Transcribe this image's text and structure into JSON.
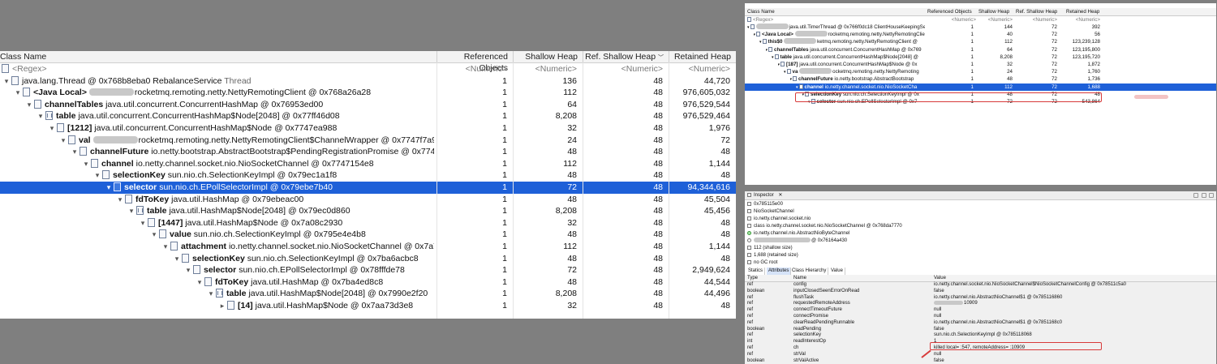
{
  "left": {
    "columns": {
      "name": "Class Name",
      "refs": "Referenced Objects",
      "shallow": "Shallow Heap",
      "ref_shallow": "Ref. Shallow Heap",
      "retained": "Retained Heap"
    },
    "filter": {
      "name": "<Regex>",
      "refs": "<Numeric>",
      "shallow": "<Numeric>",
      "ref_shallow": "<Numeric>",
      "retained": "<Numeric>"
    },
    "rows": [
      {
        "depth": 0,
        "tw": "▾",
        "icon": "thread",
        "field": "",
        "text": "java.lang.Thread @ 0x768b8eba0  RebalanceService",
        "tail": "Thread",
        "blur": false,
        "refs": "1",
        "shallow": "136",
        "ref_shallow": "48",
        "retained": "44,720"
      },
      {
        "depth": 1,
        "tw": "▾",
        "icon": "obj",
        "field": "<Java Local>",
        "text": "rocketmq.remoting.netty.NettyRemotingClient @ 0x768a26a28",
        "blur": true,
        "refs": "1",
        "shallow": "112",
        "ref_shallow": "48",
        "retained": "976,605,032"
      },
      {
        "depth": 2,
        "tw": "▾",
        "icon": "obj",
        "field": "channelTables",
        "text": "java.util.concurrent.ConcurrentHashMap @ 0x76953ed00",
        "blur": false,
        "refs": "1",
        "shallow": "64",
        "ref_shallow": "48",
        "retained": "976,529,544"
      },
      {
        "depth": 3,
        "tw": "▾",
        "icon": "arr",
        "field": "table",
        "text": "java.util.concurrent.ConcurrentHashMap$Node[2048] @ 0x77ff46d08",
        "blur": false,
        "refs": "1",
        "shallow": "8,208",
        "ref_shallow": "48",
        "retained": "976,529,464"
      },
      {
        "depth": 4,
        "tw": "▾",
        "icon": "obj",
        "field": "[1212]",
        "text": "java.util.concurrent.ConcurrentHashMap$Node @ 0x7747ea988",
        "blur": false,
        "refs": "1",
        "shallow": "32",
        "ref_shallow": "48",
        "retained": "1,976"
      },
      {
        "depth": 5,
        "tw": "▾",
        "icon": "obj",
        "field": "val",
        "text": "rocketmq.remoting.netty.NettyRemotingClient$ChannelWrapper @ 0x7747f7a9",
        "blur": true,
        "refs": "1",
        "shallow": "24",
        "ref_shallow": "48",
        "retained": "72"
      },
      {
        "depth": 6,
        "tw": "▾",
        "icon": "obj",
        "field": "channelFuture",
        "text": "io.netty.bootstrap.AbstractBootstrap$PendingRegistrationPromise @ 0x7745",
        "blur": false,
        "refs": "1",
        "shallow": "48",
        "ref_shallow": "48",
        "retained": "48"
      },
      {
        "depth": 7,
        "tw": "▾",
        "icon": "obj",
        "field": "channel",
        "text": "io.netty.channel.socket.nio.NioSocketChannel @ 0x7747154e8",
        "blur": false,
        "refs": "1",
        "shallow": "112",
        "ref_shallow": "48",
        "retained": "1,144"
      },
      {
        "depth": 8,
        "tw": "▾",
        "icon": "obj",
        "field": "selectionKey",
        "text": "sun.nio.ch.SelectionKeyImpl @ 0x79ec1a1f8",
        "blur": false,
        "refs": "1",
        "shallow": "48",
        "ref_shallow": "48",
        "retained": "48"
      },
      {
        "depth": 9,
        "tw": "▾",
        "icon": "obj",
        "field": "selector",
        "text": "sun.nio.ch.EPollSelectorImpl @ 0x79ebe7b40",
        "blur": false,
        "sel": true,
        "refs": "1",
        "shallow": "72",
        "ref_shallow": "48",
        "retained": "94,344,616"
      },
      {
        "depth": 10,
        "tw": "▾",
        "icon": "obj",
        "field": "fdToKey",
        "text": "java.util.HashMap @ 0x79ebeac00",
        "blur": false,
        "refs": "1",
        "shallow": "48",
        "ref_shallow": "48",
        "retained": "45,504"
      },
      {
        "depth": 11,
        "tw": "▾",
        "icon": "arr",
        "field": "table",
        "text": "java.util.HashMap$Node[2048] @ 0x79ec0d860",
        "blur": false,
        "refs": "1",
        "shallow": "8,208",
        "ref_shallow": "48",
        "retained": "45,456"
      },
      {
        "depth": 12,
        "tw": "▾",
        "icon": "obj",
        "field": "[1447]",
        "text": "java.util.HashMap$Node @ 0x7a08c2930",
        "blur": false,
        "refs": "1",
        "shallow": "32",
        "ref_shallow": "48",
        "retained": "48"
      },
      {
        "depth": 13,
        "tw": "▾",
        "icon": "obj",
        "field": "value",
        "text": "sun.nio.ch.SelectionKeyImpl @ 0x795e4e4b8",
        "blur": false,
        "refs": "1",
        "shallow": "48",
        "ref_shallow": "48",
        "retained": "48"
      },
      {
        "depth": 14,
        "tw": "▾",
        "icon": "obj",
        "field": "attachment",
        "text": "io.netty.channel.socket.nio.NioSocketChannel @ 0x7a7",
        "blur": false,
        "refs": "1",
        "shallow": "112",
        "ref_shallow": "48",
        "retained": "1,144"
      },
      {
        "depth": 15,
        "tw": "▾",
        "icon": "obj",
        "field": "selectionKey",
        "text": "sun.nio.ch.SelectionKeyImpl @ 0x7ba6acbc8",
        "blur": false,
        "refs": "1",
        "shallow": "48",
        "ref_shallow": "48",
        "retained": "48"
      },
      {
        "depth": 16,
        "tw": "▾",
        "icon": "obj",
        "field": "selector",
        "text": "sun.nio.ch.EPollSelectorImpl @ 0x78fffde78",
        "blur": false,
        "refs": "1",
        "shallow": "72",
        "ref_shallow": "48",
        "retained": "2,949,624"
      },
      {
        "depth": 17,
        "tw": "▾",
        "icon": "obj",
        "field": "fdToKey",
        "text": "java.util.HashMap @ 0x7ba4ed8c8",
        "blur": false,
        "refs": "1",
        "shallow": "48",
        "ref_shallow": "48",
        "retained": "44,544"
      },
      {
        "depth": 18,
        "tw": "▾",
        "icon": "arr",
        "field": "table",
        "text": "java.util.HashMap$Node[2048] @ 0x7990e2f20",
        "blur": false,
        "refs": "1",
        "shallow": "8,208",
        "ref_shallow": "48",
        "retained": "44,496"
      },
      {
        "depth": 19,
        "tw": "▸",
        "icon": "obj",
        "field": "[14]",
        "text": "java.util.HashMap$Node @ 0x7aa73d3e8",
        "blur": false,
        "refs": "1",
        "shallow": "32",
        "ref_shallow": "48",
        "retained": "48"
      }
    ]
  },
  "right_tree": {
    "columns": {
      "name": "Class Name",
      "refs": "Referenced Objects",
      "shallow": "Shallow Heap",
      "ref_shallow": "Ref. Shallow Heap",
      "retained": "Retained Heap"
    },
    "filter": {
      "name": "<Regex>",
      "num": "<Numeric>"
    },
    "rows": [
      {
        "depth": 0,
        "field": "",
        "text": "java.util.TimerThread @ 0x766f0dc18  ClientHouseKeepingService  Thread",
        "blur": true,
        "refs": "1",
        "shallow": "144",
        "ref_shallow": "72",
        "retained": "392"
      },
      {
        "depth": 1,
        "field": "<Java Local>",
        "text": "rocketmq.remoting.netty.NettyRemotingClie",
        "blur": true,
        "refs": "1",
        "shallow": "40",
        "ref_shallow": "72",
        "retained": "56"
      },
      {
        "depth": 2,
        "field": "this$0",
        "text": "ketmq.remoting.netty.NettyRemotingClient @",
        "blur": true,
        "refs": "1",
        "shallow": "112",
        "ref_shallow": "72",
        "retained": "123,239,128"
      },
      {
        "depth": 3,
        "field": "channelTables",
        "text": "java.util.concurrent.ConcurrentHashMap @ 0x769",
        "blur": false,
        "refs": "1",
        "shallow": "64",
        "ref_shallow": "72",
        "retained": "123,195,800"
      },
      {
        "depth": 4,
        "field": "table",
        "text": "java.util.concurrent.ConcurrentHashMap$Node[2048] @",
        "blur": false,
        "refs": "1",
        "shallow": "8,208",
        "ref_shallow": "72",
        "retained": "123,195,720"
      },
      {
        "depth": 5,
        "field": "[187]",
        "text": "java.util.concurrent.ConcurrentHashMap$Node @ 0x",
        "blur": false,
        "refs": "1",
        "shallow": "32",
        "ref_shallow": "72",
        "retained": "1,872"
      },
      {
        "depth": 6,
        "field": "va",
        "text": "ocketmq.remoting.netty.NettyRemoting",
        "blur": true,
        "refs": "1",
        "shallow": "24",
        "ref_shallow": "72",
        "retained": "1,760"
      },
      {
        "depth": 7,
        "field": "channelFuture",
        "text": "io.netty.bootstrap.AbstractBootstrap",
        "blur": false,
        "refs": "1",
        "shallow": "48",
        "ref_shallow": "72",
        "retained": "1,736"
      },
      {
        "depth": 8,
        "field": "channel",
        "text": "io.netty.channel.socket.nio.NioSocketCha",
        "blur": false,
        "sel": true,
        "refs": "1",
        "shallow": "112",
        "ref_shallow": "72",
        "retained": "1,688"
      },
      {
        "depth": 9,
        "field": "selectionKey",
        "text": "sun.nio.ch.SelectionKeyImpl @ 0x",
        "blur": false,
        "refs": "1",
        "shallow": "48",
        "ref_shallow": "72",
        "retained": "48"
      },
      {
        "depth": 10,
        "field": "selector",
        "text": "sun.nio.ch.EPollSelectorImpl @ 0x7",
        "blur": false,
        "refs": "1",
        "shallow": "72",
        "ref_shallow": "72",
        "retained": "543,864"
      }
    ]
  },
  "inspector": {
    "title": "Inspector",
    "lines": [
      {
        "icon": "obj",
        "text": "0x785115e00"
      },
      {
        "icon": "obj",
        "text": "NioSocketChannel"
      },
      {
        "icon": "obj",
        "text": "io.netty.channel.socket.nio"
      },
      {
        "icon": "obj",
        "text": "class io.netty.channel.socket.nio.NioSocketChannel @ 0x768da7770"
      },
      {
        "icon": "g",
        "text": "io.netty.channel.nio.AbstractNioByteChannel"
      },
      {
        "icon": "r",
        "text": "@ 0x76164a430"
      },
      {
        "icon": "obj",
        "text": "112 (shallow size)"
      },
      {
        "icon": "obj",
        "text": "1,688 (retained size)"
      },
      {
        "icon": "obj",
        "text": "no GC root"
      }
    ],
    "tabs": [
      "Statics",
      "Attributes",
      "Class Hierarchy",
      "Value"
    ],
    "active_tab": "Attributes",
    "columns": {
      "type": "Type",
      "name": "Name",
      "value": "Value"
    },
    "attributes": [
      {
        "type": "ref",
        "name": "config",
        "value": "io.netty.channel.socket.nio.NioSocketChannel$NioSocketChannelConfig @ 0x78511c5a0"
      },
      {
        "type": "boolean",
        "name": "inputClosedSeenErrorOnRead",
        "value": "false"
      },
      {
        "type": "ref",
        "name": "flushTask",
        "value": "io.netty.channel.nio.AbstractNioChannel$1 @ 0x785116860"
      },
      {
        "type": "ref",
        "name": "requestedRemoteAddress",
        "value": "10909"
      },
      {
        "type": "ref",
        "name": "connectTimeoutFuture",
        "value": "null"
      },
      {
        "type": "ref",
        "name": "connectPromise",
        "value": "null"
      },
      {
        "type": "ref",
        "name": "clearReadPendingRunnable",
        "value": "io.netty.channel.nio.AbstractNioChannel$1 @ 0x7851168c0"
      },
      {
        "type": "boolean",
        "name": "readPending",
        "value": "false"
      },
      {
        "type": "ref",
        "name": "selectionKey",
        "value": "sun.nio.ch.SelectionKeyImpl @ 0x785118068"
      },
      {
        "type": "int",
        "name": "readInterestOp",
        "value": "1"
      },
      {
        "type": "ref",
        "name": "ch",
        "value": "killed local=          :547, remoteAddress=          :10909"
      },
      {
        "type": "ref",
        "name": "strVal",
        "value": "null"
      },
      {
        "type": "boolean",
        "name": "strValActive",
        "value": "false"
      }
    ]
  },
  "colors": {
    "selection": "#1e60d8",
    "highlight": "#d83a3a",
    "background": "#7f7f7f"
  }
}
